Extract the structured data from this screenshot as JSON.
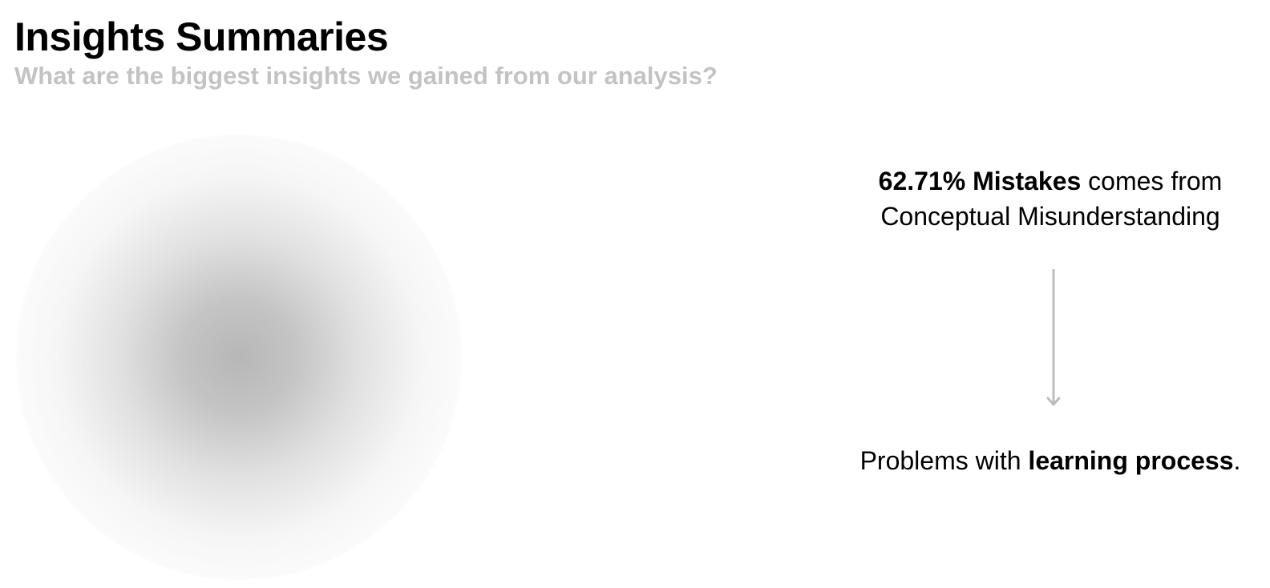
{
  "header": {
    "title": "Insights Summaries",
    "subtitle": "What are the biggest insights we gained from our analysis?"
  },
  "insights": {
    "top": {
      "highlight": "62.71% Mistakes",
      "rest_line1": " comes from",
      "line2": "Conceptual Misunderstanding"
    },
    "bottom": {
      "prefix": "Problems with ",
      "highlight": "learning process",
      "suffix": "."
    }
  },
  "colors": {
    "subtitle": "#c3c3c3",
    "arrow": "#bdbdbd",
    "blob": "#b4b4b4"
  },
  "icons": {
    "arrow": "arrow-down-icon"
  }
}
